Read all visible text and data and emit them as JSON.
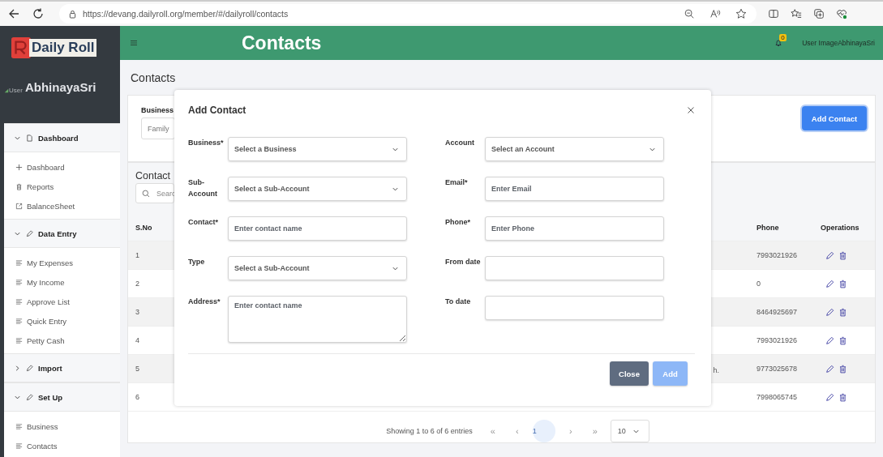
{
  "browser": {
    "url": "https://devang.dailyroll.org/member/#/dailyroll/contacts"
  },
  "sidebar": {
    "logo": "Daily Roll",
    "avatar_alt": "User",
    "user_name": "AbhinayaSri",
    "menu": [
      {
        "title": "Dashboard",
        "expanded": true,
        "items": [
          {
            "label": "Dashboard"
          },
          {
            "label": "Reports"
          },
          {
            "label": "BalanceSheet"
          }
        ]
      },
      {
        "title": "Data Entry",
        "expanded": true,
        "items": [
          {
            "label": "My Expenses"
          },
          {
            "label": "My Income"
          },
          {
            "label": "Approve List"
          },
          {
            "label": "Quick Entry"
          },
          {
            "label": "Petty Cash"
          }
        ]
      },
      {
        "title": "Import",
        "expanded": false
      },
      {
        "title": "Set Up",
        "expanded": true,
        "items": [
          {
            "label": "Business"
          },
          {
            "label": "Contacts"
          }
        ]
      }
    ]
  },
  "header": {
    "title": "Contacts",
    "notifications": "0",
    "user_image_alt": "User Image",
    "user_name": "AbhinayaSri"
  },
  "page": {
    "heading": "Contacts",
    "filter": {
      "label": "Business",
      "value": "Family"
    },
    "add_button": "Add Contact",
    "list_title": "Contact",
    "search": {
      "placeholder": "Searc"
    },
    "table": {
      "columns": [
        "S.No",
        "Phone",
        "Operations"
      ],
      "rows": [
        {
          "sno": "1",
          "phone": "7993021926"
        },
        {
          "sno": "2",
          "phone": "0"
        },
        {
          "sno": "3",
          "phone": "8464925697"
        },
        {
          "sno": "4",
          "phone": "7993021926"
        },
        {
          "sno": "5",
          "column_2": "h.",
          "phone": "9773025678"
        },
        {
          "sno": "6",
          "phone": "7998065745"
        }
      ]
    },
    "pagination": {
      "summary": "Showing 1 to 6 of 6 entries",
      "first": "«",
      "prev": "‹",
      "pages": [
        {
          "label": "1",
          "selected": true
        }
      ],
      "next": "›",
      "last": "»",
      "page_size": "10"
    }
  },
  "modal": {
    "title": "Add Contact",
    "fields": [
      {
        "label": "Business*",
        "kind": "select",
        "placeholder": "Select a Business"
      },
      {
        "label": "Account",
        "kind": "select",
        "placeholder": "Select an Account"
      },
      {
        "label": "Sub-Account",
        "kind": "select",
        "placeholder": "Select a Sub-Account"
      },
      {
        "label": "Email*",
        "kind": "text",
        "placeholder": "Enter Email"
      },
      {
        "label": "Contact*",
        "kind": "text",
        "placeholder": "Enter contact name"
      },
      {
        "label": "Phone*",
        "kind": "text",
        "placeholder": "Enter Phone"
      },
      {
        "label": "Type",
        "kind": "select",
        "placeholder": "Select a Sub-Account"
      },
      {
        "label": "From date",
        "kind": "date"
      },
      {
        "label": "Address*",
        "kind": "textarea",
        "placeholder": "Enter contact name"
      },
      {
        "label": "To date",
        "kind": "date"
      }
    ],
    "buttons": [
      {
        "label": "Close",
        "kind": "secondary",
        "disabled": false
      },
      {
        "label": "Add",
        "kind": "primary",
        "disabled": true
      }
    ]
  }
}
